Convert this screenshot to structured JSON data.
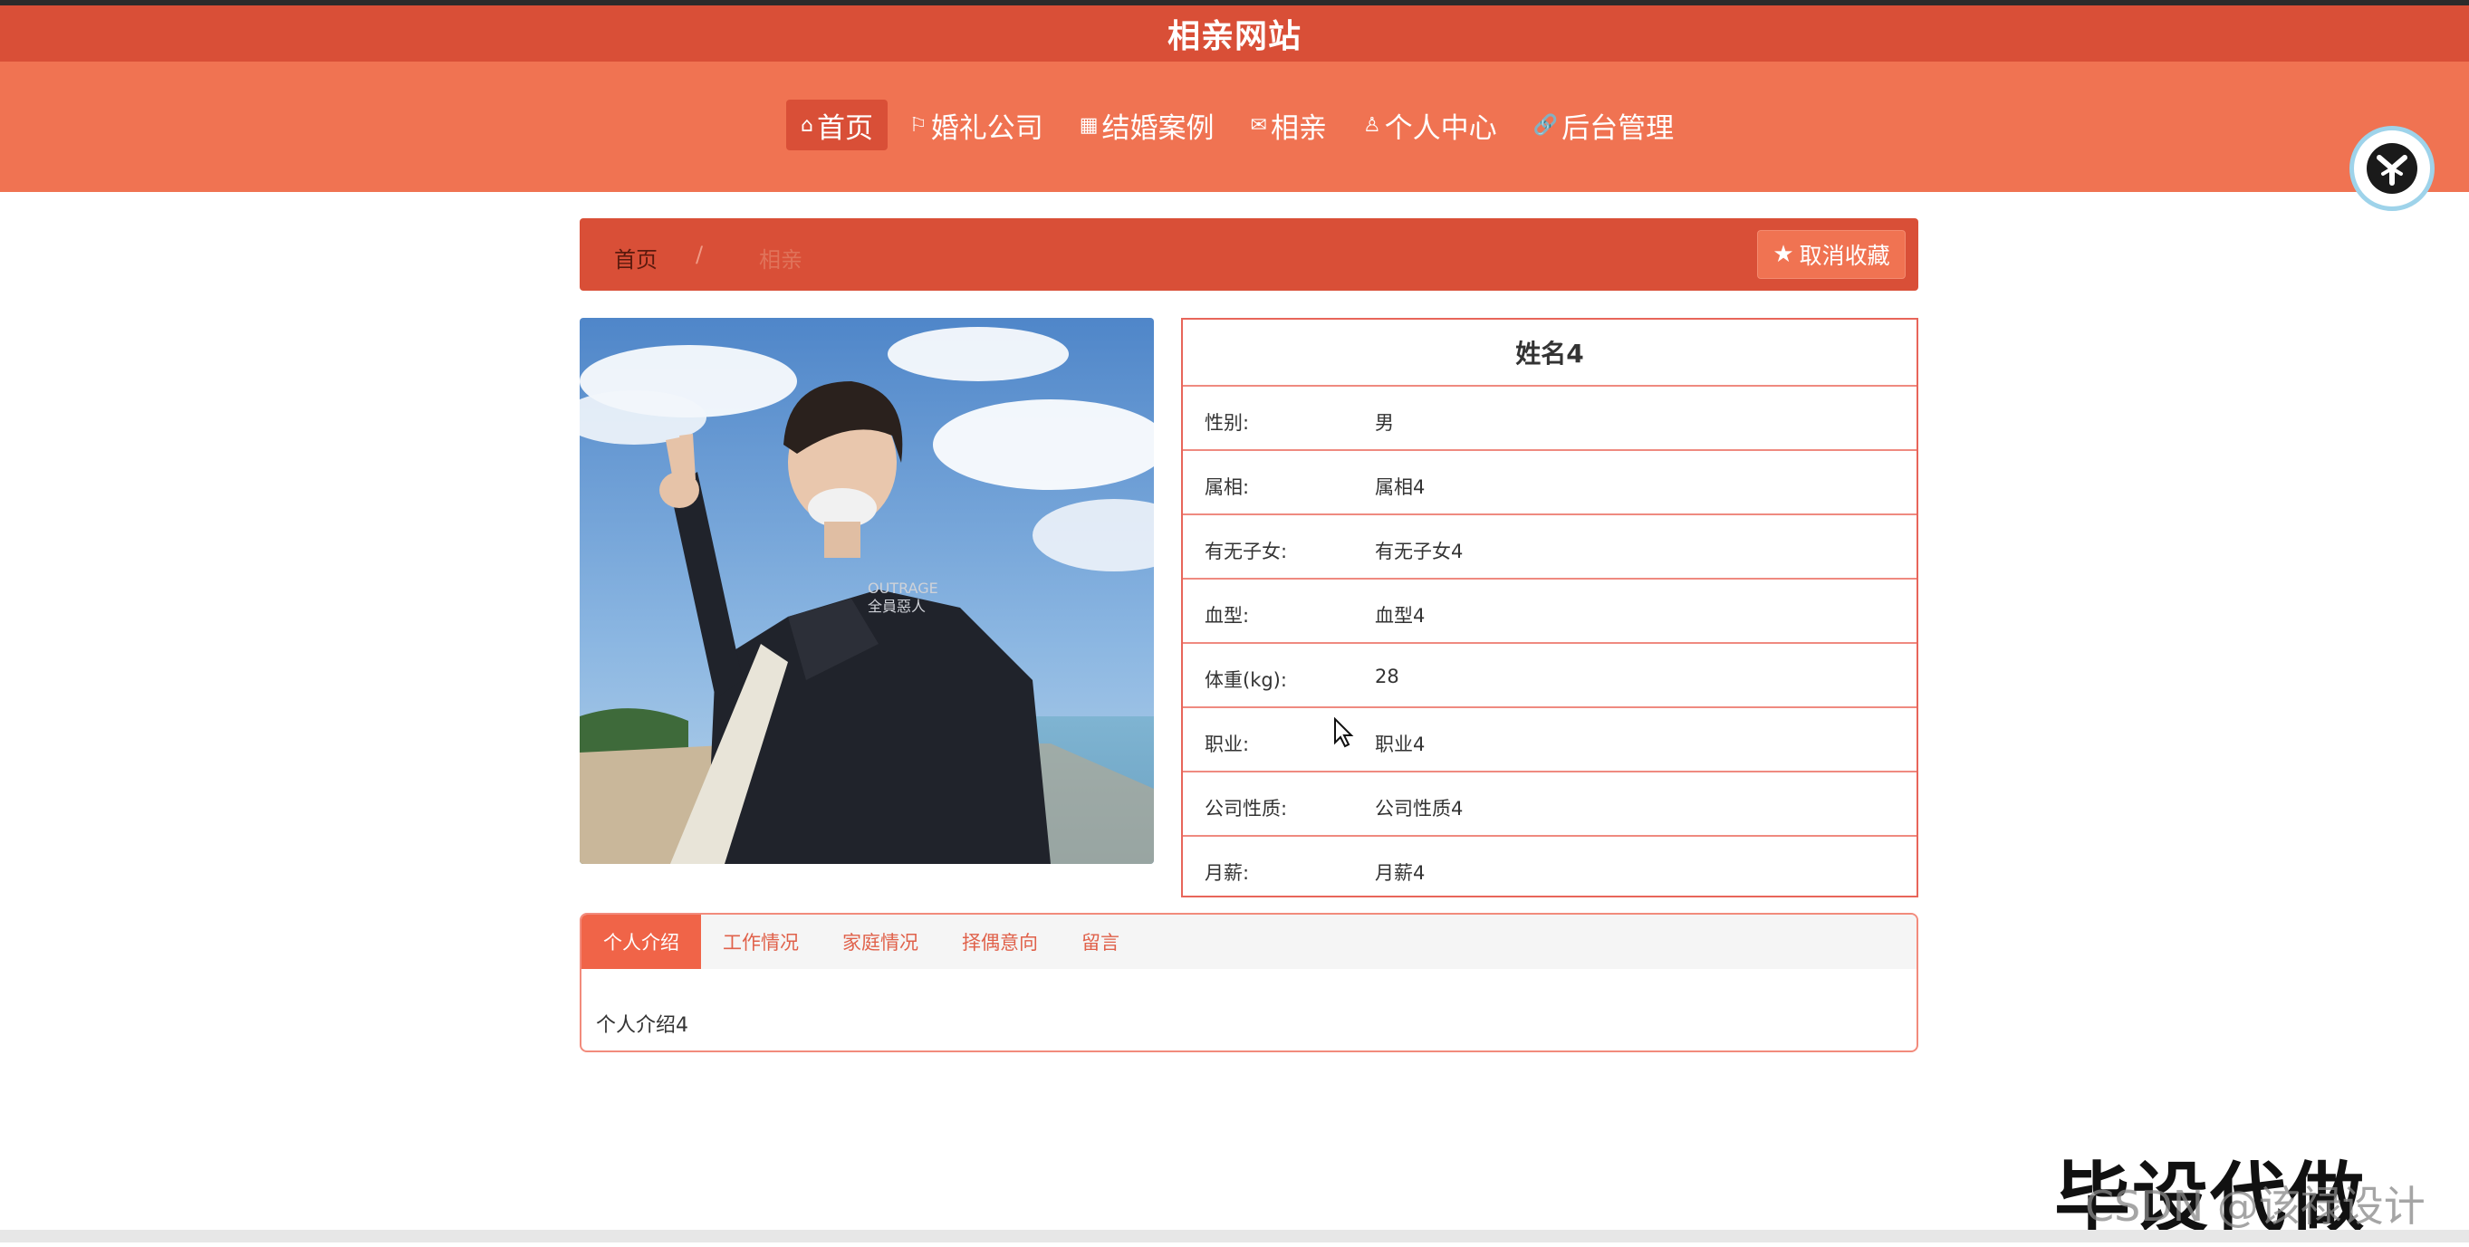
{
  "site_title": "相亲网站",
  "nav": [
    {
      "icon": "⌂",
      "label": "首页"
    },
    {
      "icon": "⚐",
      "label": "婚礼公司"
    },
    {
      "icon": "▦",
      "label": "结婚案例"
    },
    {
      "icon": "✉",
      "label": "相亲"
    },
    {
      "icon": "♙",
      "label": "个人中心"
    },
    {
      "icon": "🔗",
      "label": "后台管理"
    }
  ],
  "breadcrumb": {
    "home": "首页",
    "separator": "/",
    "current": "相亲"
  },
  "favorite_button": "取消收藏",
  "profile": {
    "name": "姓名4",
    "fields": [
      {
        "label": "性别:",
        "value": "男"
      },
      {
        "label": "属相:",
        "value": "属相4"
      },
      {
        "label": "有无子女:",
        "value": "有无子女4"
      },
      {
        "label": "血型:",
        "value": "血型4"
      },
      {
        "label": "体重(kg):",
        "value": "28"
      },
      {
        "label": "职业:",
        "value": "职业4"
      },
      {
        "label": "公司性质:",
        "value": "公司性质4"
      },
      {
        "label": "月薪:",
        "value": "月薪4"
      }
    ]
  },
  "photo": {
    "jacket_text_1": "OUTRAGE",
    "jacket_text_2": "全員惡人"
  },
  "tabs": [
    "个人介绍",
    "工作情况",
    "家庭情况",
    "择偶意向",
    "留言"
  ],
  "tab_content": "个人介绍4",
  "watermark": {
    "big": "毕设代做",
    "small": "CSDN @该禄设计"
  },
  "colors": {
    "title_red": "#d94f37",
    "nav_orange": "#f07352",
    "border_red": "#e8655a"
  }
}
